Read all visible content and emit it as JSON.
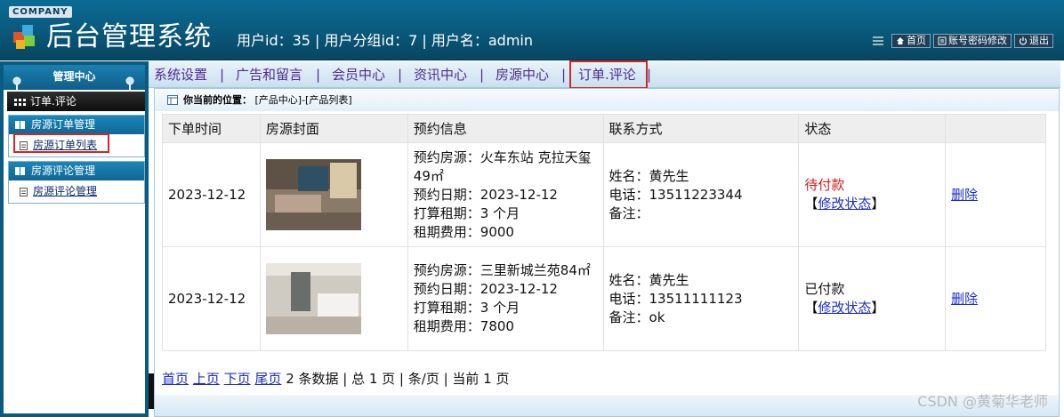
{
  "header": {
    "company": "COMPANY",
    "title": "后台管理系统",
    "user_info": "用户id：35 | 用户分组id：7 | 用户名：admin",
    "actions": {
      "home": "首页",
      "account": "账号密码修改",
      "logout": "退出"
    }
  },
  "sidebar": {
    "title": "管理中心",
    "module": "订单.评论",
    "groups": [
      {
        "title": "房源订单管理",
        "items": [
          "房源订单列表"
        ]
      },
      {
        "title": "房源评论管理",
        "items": [
          "房源评论管理"
        ]
      }
    ]
  },
  "topnav": {
    "items": [
      "系统设置",
      "广告和留言",
      "会员中心",
      "资讯中心",
      "房源中心",
      "订单.评论"
    ],
    "separator": "|"
  },
  "main": {
    "location_label": "你当前的位置：",
    "location_value": "[产品中心]-[产品列表]",
    "columns": [
      "下单时间",
      "房源封面",
      "预约信息",
      "联系方式",
      "状态",
      ""
    ],
    "rows": [
      {
        "date": "2023-12-12",
        "booking": [
          "预约房源：火车东站 克拉天玺49㎡",
          "预约日期：2023-12-12",
          "打算租期：3 个月",
          "租期费用：9000"
        ],
        "contact": [
          "姓名：黄先生",
          "电话：13511223344",
          "备注："
        ],
        "status": "待付款",
        "status_action": "修改状态",
        "delete": "删除"
      },
      {
        "date": "2023-12-12",
        "booking": [
          "预约房源：三里新城兰苑84㎡",
          "预约日期：2023-12-12",
          "打算租期：3 个月",
          "租期费用：7800"
        ],
        "contact": [
          "姓名：黄先生",
          "电话：13511111123",
          "备注：ok"
        ],
        "status": "已付款",
        "status_action": "修改状态",
        "delete": "删除"
      }
    ],
    "pager": {
      "first": "首页",
      "prev": "上页",
      "next": "下页",
      "last": "尾页",
      "summary": "2 条数据 | 总 1 页 | 条/页 | 当前 1 页"
    }
  },
  "watermark": "CSDN @黄菊华老师",
  "colors": {
    "header": "#0a5c80",
    "accent_red": "#d62424",
    "nav_text": "#522b92",
    "link": "#1a2ecc"
  }
}
